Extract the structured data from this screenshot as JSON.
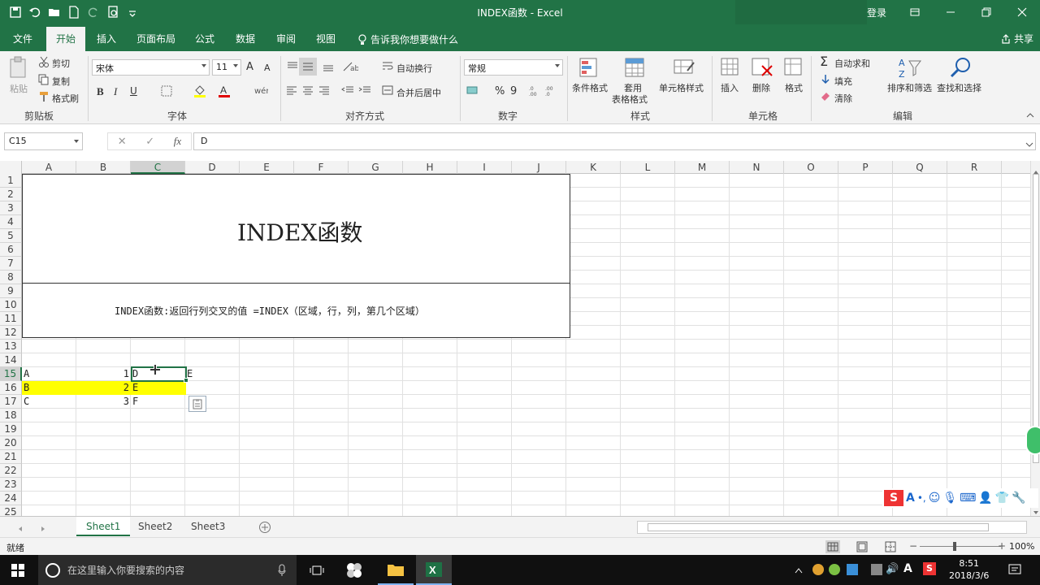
{
  "window": {
    "title": "INDEX函数 - Excel",
    "login": "登录"
  },
  "ribbon_tabs": [
    "文件",
    "开始",
    "插入",
    "页面布局",
    "公式",
    "数据",
    "审阅",
    "视图"
  ],
  "tell_me": "告诉我你想要做什么",
  "share": "共享",
  "clipboard": {
    "paste": "粘贴",
    "cut": "剪切",
    "copy": "复制",
    "format_painter": "格式刷",
    "group": "剪贴板"
  },
  "font": {
    "name": "宋体",
    "size": "11",
    "bold": "B",
    "italic": "I",
    "underline": "U",
    "grow": "A",
    "shrink": "A",
    "group": "字体"
  },
  "alignment": {
    "wrap_text": "自动换行",
    "merge_center": "合并后居中",
    "group": "对齐方式"
  },
  "number": {
    "format": "常规",
    "percent": "%",
    "comma": "9",
    "group": "数字"
  },
  "styles": {
    "conditional": "条件格式",
    "table_1": "套用",
    "table_2": "表格格式",
    "cell_styles": "单元格样式",
    "group": "样式"
  },
  "cells_group": {
    "insert": "插入",
    "delete": "删除",
    "format": "格式",
    "group": "单元格"
  },
  "editing": {
    "autosum": "自动求和",
    "fill": "填充",
    "clear": "清除",
    "sort_filter": "排序和筛选",
    "find_select": "查找和选择",
    "group": "编辑"
  },
  "formula_bar": {
    "name_box": "C15",
    "cancel": "✕",
    "enter": "✓",
    "fx": "fx",
    "value": "D"
  },
  "columns": [
    "A",
    "B",
    "C",
    "D",
    "E",
    "F",
    "G",
    "H",
    "I",
    "J",
    "K",
    "L",
    "M",
    "N",
    "O",
    "P",
    "Q",
    "R"
  ],
  "rows": [
    "1",
    "2",
    "3",
    "4",
    "5",
    "6",
    "7",
    "8",
    "9",
    "10",
    "11",
    "12",
    "13",
    "14",
    "15",
    "16",
    "17",
    "18",
    "19",
    "20",
    "21",
    "22",
    "23",
    "24",
    "25"
  ],
  "sheet": {
    "title": "INDEX函数",
    "description": "INDEX函数:返回行列交叉的值   =INDEX（区域，行，列，第几个区域）",
    "A15": "A",
    "B15": "1",
    "C15": "D",
    "D15": "E",
    "A16": "B",
    "B16": "2",
    "C16": "E",
    "A17": "C",
    "B17": "3",
    "C17": "F"
  },
  "sheet_tabs": [
    "Sheet1",
    "Sheet2",
    "Sheet3"
  ],
  "status": {
    "ready": "就绪",
    "zoom": "100%"
  },
  "taskbar": {
    "search_placeholder": "在这里输入你要搜索的内容",
    "time": "8:51",
    "date": "2018/3/6",
    "ime_letter": "A"
  },
  "colors": {
    "excel_green": "#217346",
    "highlight_yellow": "#ffff00"
  }
}
